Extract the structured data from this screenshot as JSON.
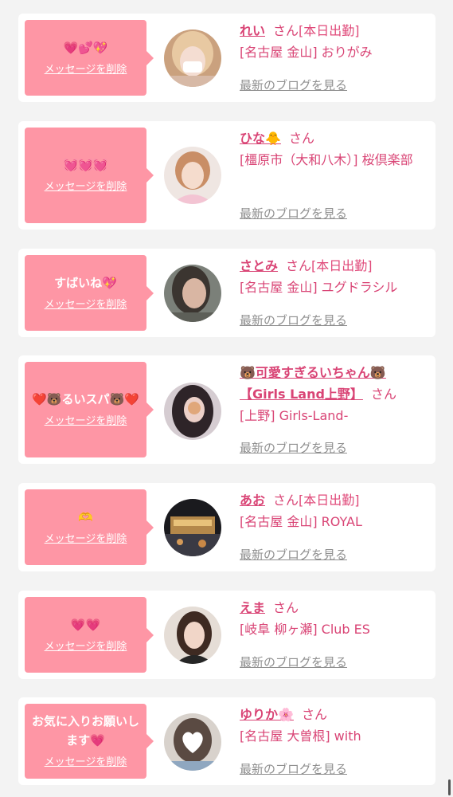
{
  "cards": [
    {
      "message": "💗💕💖",
      "delete_label": "メッセージを削除",
      "name": "れい",
      "san": "さん",
      "shop_line1": "[本日出勤]",
      "shop_line2": "[名古屋 金山] おりがみ",
      "blog_label": "最新のブログを見る"
    },
    {
      "message": "💓💓💓",
      "delete_label": "メッセージを削除",
      "name": "ひな🐥",
      "san": "さん",
      "shop_line1": "",
      "shop_line2": "[橿原市（大和八木）] 桜倶楽部",
      "blog_label": "最新のブログを見る"
    },
    {
      "message": "すばいね💖",
      "delete_label": "メッセージを削除",
      "name": "さとみ",
      "san": "さん",
      "shop_line1": "[本日出勤]",
      "shop_line2": "[名古屋 金山] ユグドラシル",
      "blog_label": "最新のブログを見る"
    },
    {
      "message": "❤️🐻るいスパ🐻❤️",
      "delete_label": "メッセージを削除",
      "name": "🐻可愛すぎるいちゃん🐻【Girls Land上野】",
      "san": "さん",
      "shop_line1": "",
      "shop_line2": "[上野] Girls-Land-",
      "blog_label": "最新のブログを見る"
    },
    {
      "message": "🫶",
      "delete_label": "メッセージを削除",
      "name": "あお",
      "san": "さん",
      "shop_line1": "[本日出勤]",
      "shop_line2": "[名古屋 金山] ROYAL",
      "blog_label": "最新のブログを見る"
    },
    {
      "message": "💗💗",
      "delete_label": "メッセージを削除",
      "name": "えま",
      "san": "さん",
      "shop_line1": "",
      "shop_line2": "[岐阜 柳ヶ瀬] Club ES",
      "blog_label": "最新のブログを見る"
    },
    {
      "message": "お気に入りお願いします💗",
      "delete_label": "メッセージを削除",
      "name": "ゆりか🌸",
      "san": "さん",
      "shop_line1": "",
      "shop_line2": "[名古屋 大曽根] with",
      "blog_label": "最新のブログを見る"
    }
  ]
}
